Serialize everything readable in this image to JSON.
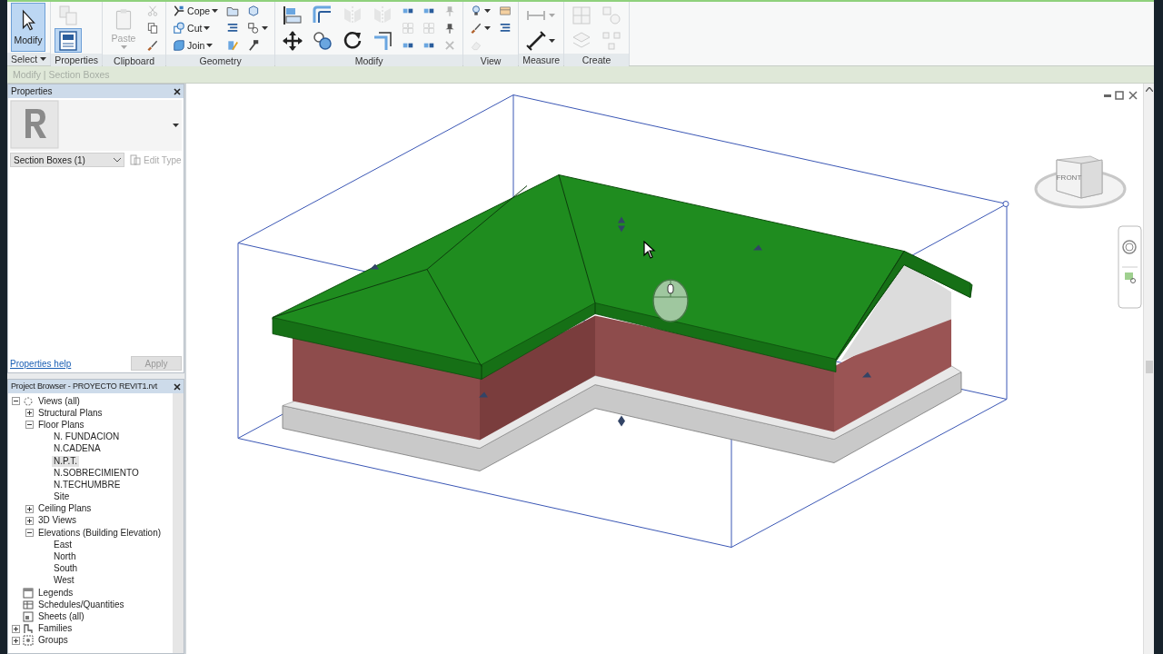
{
  "ribbon": {
    "panels": [
      {
        "label": "Select",
        "dropdown": true,
        "columns": [
          [
            {
              "kind": "large",
              "label": "Modify",
              "selected": true
            }
          ]
        ]
      },
      {
        "label": "Properties",
        "columns": [
          [
            {
              "kind": "medium",
              "selected": false,
              "disabled": true
            },
            {
              "kind": "medium",
              "selected": true
            }
          ]
        ]
      },
      {
        "label": "Clipboard",
        "columns": [
          [
            {
              "kind": "large",
              "label": "Paste",
              "selected": false,
              "disabled": true,
              "dropdown": true
            }
          ],
          [
            {
              "kind": "small",
              "selected": false,
              "disabled": true
            },
            {
              "kind": "small",
              "selected": false
            },
            {
              "kind": "small",
              "selected": false
            }
          ]
        ]
      },
      {
        "label": "Geometry",
        "columns": [
          [
            {
              "kind": "small",
              "label": "Cope",
              "selected": false,
              "dropdown": true
            },
            {
              "kind": "small",
              "label": "Cut",
              "selected": false,
              "dropdown": true
            },
            {
              "kind": "small",
              "label": "Join",
              "selected": false,
              "dropdown": true
            }
          ],
          [
            {
              "kind": "small",
              "selected": false
            },
            {
              "kind": "small",
              "selected": false
            },
            {
              "kind": "small",
              "selected": false
            }
          ],
          [
            {
              "kind": "small",
              "selected": false
            },
            {
              "kind": "small",
              "selected": false,
              "dropdown": true
            },
            {
              "kind": "small",
              "selected": false
            }
          ]
        ]
      },
      {
        "label": "Modify",
        "columns": [
          [
            {
              "kind": "medium",
              "selected": false
            },
            {
              "kind": "medium",
              "selected": false
            }
          ],
          [
            {
              "kind": "medium",
              "selected": false
            },
            {
              "kind": "medium",
              "selected": false
            }
          ],
          [
            {
              "kind": "medium",
              "selected": false,
              "disabled": true
            },
            {
              "kind": "medium",
              "selected": false
            }
          ],
          [
            {
              "kind": "medium",
              "selected": false,
              "disabled": true
            },
            {
              "kind": "medium",
              "selected": false
            }
          ],
          [
            {
              "kind": "small",
              "selected": false
            },
            {
              "kind": "small",
              "selected": false,
              "disabled": true
            },
            {
              "kind": "small",
              "selected": false
            }
          ],
          [
            {
              "kind": "small",
              "selected": false
            },
            {
              "kind": "small",
              "selected": false,
              "disabled": true
            },
            {
              "kind": "small",
              "selected": false
            }
          ],
          [
            {
              "kind": "small",
              "selected": false,
              "disabled": true
            },
            {
              "kind": "small",
              "selected": false
            },
            {
              "kind": "small",
              "selected": false,
              "disabled": true
            }
          ]
        ]
      },
      {
        "label": "View",
        "columns": [
          [
            {
              "kind": "small",
              "selected": false,
              "dropdown": true
            },
            {
              "kind": "small",
              "selected": false,
              "dropdown": true
            },
            {
              "kind": "small",
              "selected": false,
              "disabled": true
            }
          ],
          [
            {
              "kind": "small",
              "selected": false
            },
            {
              "kind": "small",
              "selected": false
            }
          ]
        ]
      },
      {
        "label": "Measure",
        "columns": [
          [
            {
              "kind": "medium",
              "selected": false,
              "disabled": true,
              "dropdown": true
            },
            {
              "kind": "medium",
              "selected": false,
              "dropdown": true
            }
          ]
        ]
      },
      {
        "label": "Create",
        "columns": [
          [
            {
              "kind": "medium",
              "selected": false,
              "disabled": true
            },
            {
              "kind": "medium",
              "selected": false,
              "disabled": true
            }
          ],
          [
            {
              "kind": "medium",
              "selected": false,
              "disabled": true
            },
            {
              "kind": "medium",
              "selected": false,
              "disabled": true
            }
          ]
        ]
      }
    ]
  },
  "context_bar": {
    "label": "Modify | Section Boxes"
  },
  "properties": {
    "title": "Properties",
    "type_selector": "Section Boxes (1)",
    "edit_type": {
      "label": "Edit Type",
      "disabled": true
    },
    "help_link": "Properties help",
    "apply": {
      "label": "Apply",
      "disabled": true
    }
  },
  "project_browser": {
    "title": "Project Browser - PROYECTO REVIT1.rvt",
    "tree": [
      {
        "label": "Views (all)",
        "expanded": true,
        "selected": false,
        "children": [
          {
            "label": "Structural Plans",
            "expanded": false,
            "selected": false
          },
          {
            "label": "Floor Plans",
            "expanded": true,
            "selected": false,
            "children": [
              {
                "label": "N. FUNDACION",
                "selected": false
              },
              {
                "label": "N.CADENA",
                "selected": false
              },
              {
                "label": "N.P.T.",
                "selected": true
              },
              {
                "label": "N.SOBRECIMIENTO",
                "selected": false
              },
              {
                "label": "N.TECHUMBRE",
                "selected": false
              },
              {
                "label": "Site",
                "selected": false
              }
            ]
          },
          {
            "label": "Ceiling Plans",
            "expanded": false,
            "selected": false
          },
          {
            "label": "3D Views",
            "expanded": false,
            "selected": false
          },
          {
            "label": "Elevations (Building Elevation)",
            "expanded": true,
            "selected": false,
            "children": [
              {
                "label": "East",
                "selected": false
              },
              {
                "label": "North",
                "selected": false
              },
              {
                "label": "South",
                "selected": false
              },
              {
                "label": "West",
                "selected": false
              }
            ]
          }
        ]
      },
      {
        "label": "Legends",
        "selected": false
      },
      {
        "label": "Schedules/Quantities",
        "selected": false
      },
      {
        "label": "Sheets (all)",
        "selected": false
      },
      {
        "label": "Families",
        "expanded": false,
        "selected": false
      },
      {
        "label": "Groups",
        "expanded": false,
        "selected": false
      }
    ]
  },
  "view": {
    "viewcube_label": "FRONT"
  }
}
